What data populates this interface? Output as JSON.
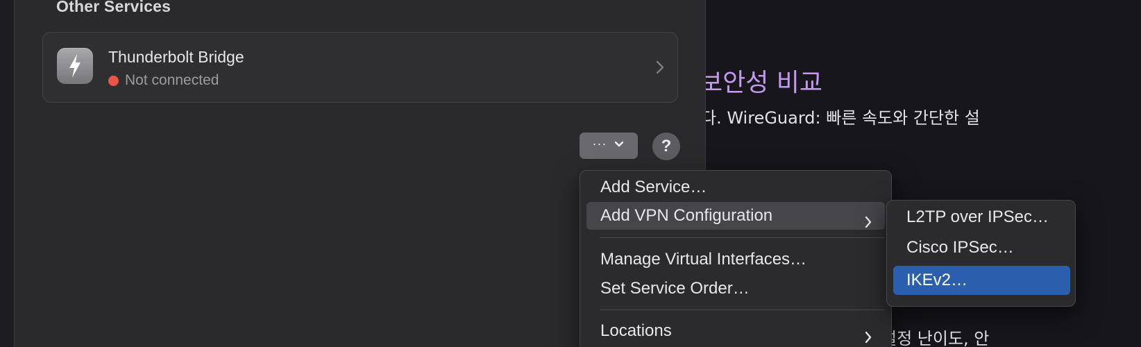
{
  "panel": {
    "section_title": "Other Services",
    "service": {
      "name": "Thunderbolt Bridge",
      "status": "Not connected",
      "status_color": "#ec5545",
      "icon": "thunderbolt-icon"
    },
    "more_button": {
      "dots": "···",
      "icon": "chevron-down-icon"
    },
    "help_button": {
      "label": "?"
    }
  },
  "background_doc": {
    "heading": "보안성 비교",
    "line1": "다. WireGuard: 빠른 속도와 간단한 설",
    "line2": "설정 난이도, 안"
  },
  "menu": {
    "items": [
      {
        "label": "Add Service…"
      },
      {
        "label": "Add VPN Configuration",
        "has_submenu": true
      },
      {
        "label": "Manage Virtual Interfaces…"
      },
      {
        "label": "Set Service Order…"
      },
      {
        "label": "Locations",
        "has_submenu": true
      }
    ]
  },
  "submenu": {
    "items": [
      {
        "label": "L2TP over IPSec…"
      },
      {
        "label": "Cisco IPSec…"
      },
      {
        "label": "IKEv2…",
        "selected": true
      }
    ],
    "selected_color": "#2b5fae"
  }
}
